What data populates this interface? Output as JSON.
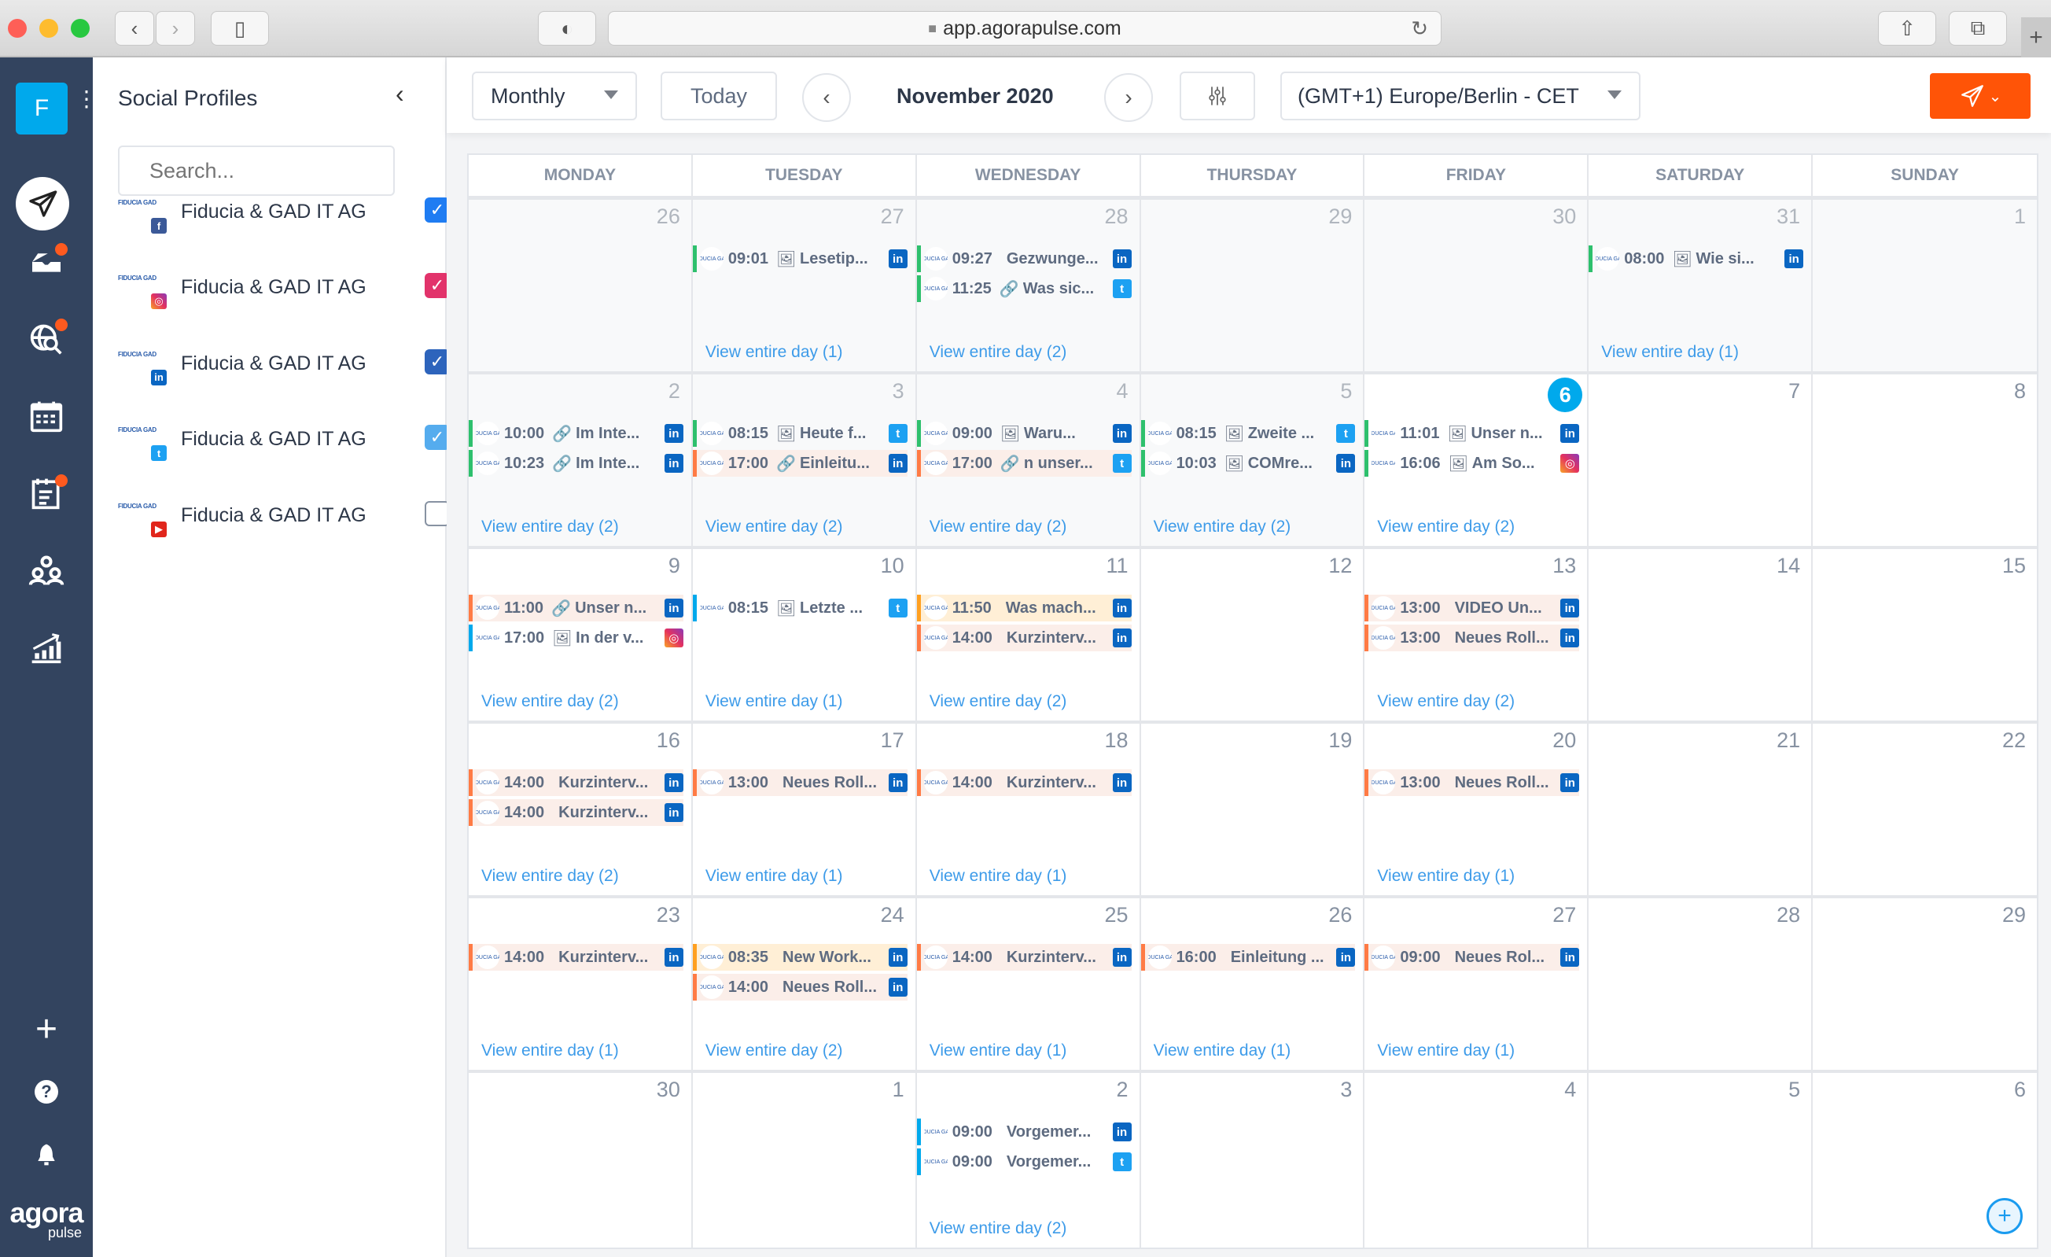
{
  "browser": {
    "url": "app.agorapulse.com",
    "icons": {
      "back": "chevron-left-icon",
      "forward": "chevron-right-icon",
      "sidebar": "sidebar-icon",
      "privacy": "shield-icon",
      "reload": "reload-icon",
      "share": "share-icon",
      "tabs": "tabs-icon",
      "new_tab": "plus-icon"
    }
  },
  "nav": {
    "account_initial": "F",
    "items": [
      {
        "name": "publish",
        "icon": "paper-plane-icon",
        "active": true,
        "badge": false
      },
      {
        "name": "inbox",
        "icon": "inbox-icon",
        "active": false,
        "badge": true
      },
      {
        "name": "listening",
        "icon": "globe-search-icon",
        "active": false,
        "badge": true
      },
      {
        "name": "calendar",
        "icon": "calendar-icon",
        "active": false,
        "badge": false
      },
      {
        "name": "reports-list",
        "icon": "clipboard-icon",
        "active": false,
        "badge": true
      },
      {
        "name": "team",
        "icon": "users-icon",
        "active": false,
        "badge": false
      },
      {
        "name": "analytics",
        "icon": "chart-icon",
        "active": false,
        "badge": false
      }
    ],
    "bottom": {
      "add": "+",
      "help": "?",
      "bell": "bell-icon"
    },
    "logo_top": "agora",
    "logo_bottom": "pulse"
  },
  "panel": {
    "title": "Social Profiles",
    "search_placeholder": "Search...",
    "profiles": [
      {
        "name": "Fiducia & GAD IT AG",
        "network": "facebook",
        "checked": true,
        "check_color": "#1f7cf2"
      },
      {
        "name": "Fiducia & GAD IT AG",
        "network": "instagram",
        "checked": true,
        "check_color": "#e2336b"
      },
      {
        "name": "Fiducia & GAD IT AG",
        "network": "linkedin",
        "checked": true,
        "check_color": "#2d64bc"
      },
      {
        "name": "Fiducia & GAD IT AG",
        "network": "twitter",
        "checked": true,
        "check_color": "#55acee"
      },
      {
        "name": "Fiducia & GAD IT AG",
        "network": "youtube",
        "checked": false,
        "check_color": "#ffffff"
      }
    ],
    "profile_logo_text": "FIDUCIA GAD"
  },
  "toolbar": {
    "view": "Monthly",
    "today": "Today",
    "month": "November 2020",
    "timezone": "(GMT+1) Europe/Berlin - CET"
  },
  "calendar": {
    "weekdays": [
      "MONDAY",
      "TUESDAY",
      "WEDNESDAY",
      "THURSDAY",
      "FRIDAY",
      "SATURDAY",
      "SUNDAY"
    ],
    "more_label": "View entire day",
    "weeks": [
      [
        {
          "day": "26",
          "past": true,
          "events": [],
          "count": null
        },
        {
          "day": "27",
          "past": true,
          "count": 1,
          "events": [
            {
              "time": "09:01",
              "kind": "image",
              "title": "Lesetip...",
              "network": "linkedin",
              "style": "green"
            }
          ]
        },
        {
          "day": "28",
          "past": true,
          "count": 2,
          "events": [
            {
              "time": "09:27",
              "kind": "none",
              "title": "Gezwunge...",
              "network": "linkedin",
              "style": "green"
            },
            {
              "time": "11:25",
              "kind": "link",
              "title": "Was sic...",
              "network": "twitter",
              "style": "green"
            }
          ]
        },
        {
          "day": "29",
          "past": true,
          "events": [],
          "count": null
        },
        {
          "day": "30",
          "past": true,
          "events": [],
          "count": null
        },
        {
          "day": "31",
          "past": true,
          "count": 1,
          "events": [
            {
              "time": "08:00",
              "kind": "image",
              "title": "Wie si...",
              "network": "linkedin",
              "style": "green"
            }
          ]
        },
        {
          "day": "1",
          "past": true,
          "events": [],
          "count": null
        }
      ],
      [
        {
          "day": "2",
          "past": true,
          "count": 2,
          "events": [
            {
              "time": "10:00",
              "kind": "link",
              "title": "Im Inte...",
              "network": "linkedin",
              "style": "green"
            },
            {
              "time": "10:23",
              "kind": "link",
              "title": "Im Inte...",
              "network": "linkedin",
              "style": "green"
            }
          ]
        },
        {
          "day": "3",
          "past": true,
          "count": 2,
          "events": [
            {
              "time": "08:15",
              "kind": "image",
              "title": "Heute f...",
              "network": "twitter",
              "style": "green"
            },
            {
              "time": "17:00",
              "kind": "link",
              "title": "Einleitu...",
              "network": "linkedin",
              "style": "pink"
            }
          ]
        },
        {
          "day": "4",
          "past": true,
          "count": 2,
          "events": [
            {
              "time": "09:00",
              "kind": "image",
              "title": "Waru...",
              "network": "linkedin",
              "style": "green"
            },
            {
              "time": "17:00",
              "kind": "link",
              "title": "n unser...",
              "network": "twitter",
              "style": "pink"
            }
          ]
        },
        {
          "day": "5",
          "past": true,
          "count": 2,
          "events": [
            {
              "time": "08:15",
              "kind": "image",
              "title": "Zweite ...",
              "network": "twitter",
              "style": "green"
            },
            {
              "time": "10:03",
              "kind": "image",
              "title": "COMre...",
              "network": "linkedin",
              "style": "green"
            }
          ]
        },
        {
          "day": "6",
          "today": true,
          "past": false,
          "count": 2,
          "events": [
            {
              "time": "11:01",
              "kind": "image",
              "title": "Unser n...",
              "network": "linkedin",
              "style": "green"
            },
            {
              "time": "16:06",
              "kind": "image",
              "title": "Am So...",
              "network": "instagram",
              "style": "green"
            }
          ]
        },
        {
          "day": "7",
          "past": false,
          "events": [],
          "count": null
        },
        {
          "day": "8",
          "past": false,
          "events": [],
          "count": null
        }
      ],
      [
        {
          "day": "9",
          "past": false,
          "count": 2,
          "events": [
            {
              "time": "11:00",
              "kind": "link",
              "title": "Unser n...",
              "network": "linkedin",
              "style": "pink"
            },
            {
              "time": "17:00",
              "kind": "image",
              "title": "In der v...",
              "network": "instagram",
              "style": "blue"
            }
          ]
        },
        {
          "day": "10",
          "past": false,
          "count": 1,
          "events": [
            {
              "time": "08:15",
              "kind": "image",
              "title": "Letzte ...",
              "network": "twitter",
              "style": "blue"
            }
          ]
        },
        {
          "day": "11",
          "past": false,
          "count": 2,
          "events": [
            {
              "time": "11:50",
              "kind": "none",
              "title": "Was mach...",
              "network": "linkedin",
              "style": "yellow"
            },
            {
              "time": "14:00",
              "kind": "none",
              "title": "Kurzinterv...",
              "network": "linkedin",
              "style": "pink"
            }
          ]
        },
        {
          "day": "12",
          "past": false,
          "events": [],
          "count": null
        },
        {
          "day": "13",
          "past": false,
          "count": 2,
          "events": [
            {
              "time": "13:00",
              "kind": "none",
              "title": "VIDEO Un...",
              "network": "linkedin",
              "style": "pink"
            },
            {
              "time": "13:00",
              "kind": "none",
              "title": "Neues Roll...",
              "network": "linkedin",
              "style": "pink"
            }
          ]
        },
        {
          "day": "14",
          "past": false,
          "events": [],
          "count": null
        },
        {
          "day": "15",
          "past": false,
          "events": [],
          "count": null
        }
      ],
      [
        {
          "day": "16",
          "past": false,
          "count": 2,
          "events": [
            {
              "time": "14:00",
              "kind": "none",
              "title": "Kurzinterv...",
              "network": "linkedin",
              "style": "pink"
            },
            {
              "time": "14:00",
              "kind": "none",
              "title": "Kurzinterv...",
              "network": "linkedin",
              "style": "pink"
            }
          ]
        },
        {
          "day": "17",
          "past": false,
          "count": 1,
          "events": [
            {
              "time": "13:00",
              "kind": "none",
              "title": "Neues Roll...",
              "network": "linkedin",
              "style": "pink"
            }
          ]
        },
        {
          "day": "18",
          "past": false,
          "count": 1,
          "events": [
            {
              "time": "14:00",
              "kind": "none",
              "title": "Kurzinterv...",
              "network": "linkedin",
              "style": "pink"
            }
          ]
        },
        {
          "day": "19",
          "past": false,
          "events": [],
          "count": null
        },
        {
          "day": "20",
          "past": false,
          "count": 1,
          "events": [
            {
              "time": "13:00",
              "kind": "none",
              "title": "Neues Roll...",
              "network": "linkedin",
              "style": "pink"
            }
          ]
        },
        {
          "day": "21",
          "past": false,
          "events": [],
          "count": null
        },
        {
          "day": "22",
          "past": false,
          "events": [],
          "count": null
        }
      ],
      [
        {
          "day": "23",
          "past": false,
          "count": 1,
          "events": [
            {
              "time": "14:00",
              "kind": "none",
              "title": "Kurzinterv...",
              "network": "linkedin",
              "style": "pink"
            }
          ]
        },
        {
          "day": "24",
          "past": false,
          "count": 2,
          "events": [
            {
              "time": "08:35",
              "kind": "none",
              "title": "New Work...",
              "network": "linkedin",
              "style": "yellow"
            },
            {
              "time": "14:00",
              "kind": "none",
              "title": "Neues Roll...",
              "network": "linkedin",
              "style": "pink"
            }
          ]
        },
        {
          "day": "25",
          "past": false,
          "count": 1,
          "events": [
            {
              "time": "14:00",
              "kind": "none",
              "title": "Kurzinterv...",
              "network": "linkedin",
              "style": "pink"
            }
          ]
        },
        {
          "day": "26",
          "past": false,
          "count": 1,
          "events": [
            {
              "time": "16:00",
              "kind": "none",
              "title": "Einleitung ...",
              "network": "linkedin",
              "style": "pink"
            }
          ]
        },
        {
          "day": "27",
          "past": false,
          "count": 1,
          "events": [
            {
              "time": "09:00",
              "kind": "none",
              "title": "Neues Rol...",
              "network": "linkedin",
              "style": "pink"
            }
          ]
        },
        {
          "day": "28",
          "past": false,
          "events": [],
          "count": null
        },
        {
          "day": "29",
          "past": false,
          "events": [],
          "count": null
        }
      ],
      [
        {
          "day": "30",
          "past": false,
          "events": [],
          "count": null
        },
        {
          "day": "1",
          "past": false,
          "events": [],
          "count": null
        },
        {
          "day": "2",
          "past": false,
          "count": 2,
          "events": [
            {
              "time": "09:00",
              "kind": "none",
              "title": "Vorgemer...",
              "network": "linkedin",
              "style": "blue"
            },
            {
              "time": "09:00",
              "kind": "none",
              "title": "Vorgemer...",
              "network": "twitter",
              "style": "blue"
            }
          ]
        },
        {
          "day": "3",
          "past": false,
          "events": [],
          "count": null
        },
        {
          "day": "4",
          "past": false,
          "events": [],
          "count": null
        },
        {
          "day": "5",
          "past": false,
          "events": [],
          "count": null
        },
        {
          "day": "6",
          "past": false,
          "events": [],
          "count": null
        }
      ]
    ]
  },
  "network_glyphs": {
    "linkedin": "in",
    "twitter": "t",
    "instagram": "◎",
    "facebook": "f",
    "youtube": "▶"
  },
  "kind_glyphs": {
    "image": "🖼",
    "link": "🔗",
    "none": ""
  },
  "colors": {
    "accent": "#ff5407",
    "today": "#00a9ec",
    "nav_bg": "#33445f",
    "link": "#3d9be9"
  }
}
